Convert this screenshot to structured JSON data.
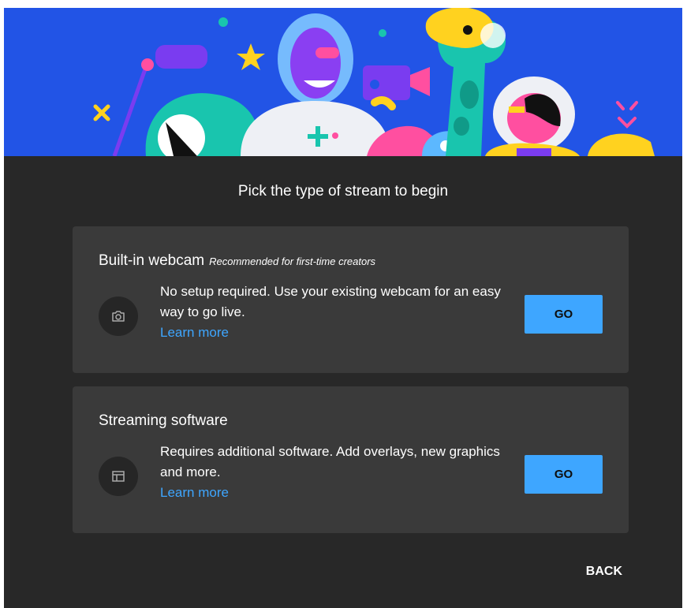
{
  "dialog": {
    "title": "Pick the type of stream to begin",
    "back_label": "BACK"
  },
  "options": [
    {
      "heading": "Built-in webcam",
      "recommendation": "Recommended for first-time creators",
      "description": "No setup required. Use your existing webcam for an easy way to go live.",
      "learn_more": "Learn more",
      "go_label": "GO",
      "icon": "camera-icon"
    },
    {
      "heading": "Streaming software",
      "description": "Requires additional software. Add overlays, new graphics and more.",
      "learn_more": "Learn more",
      "go_label": "GO",
      "icon": "layout-icon"
    }
  ],
  "colors": {
    "banner": "#2254e6",
    "dialog_bg": "#282828",
    "card_bg": "#3a3a3a",
    "accent": "#3ea6ff",
    "text": "#ffffff"
  }
}
